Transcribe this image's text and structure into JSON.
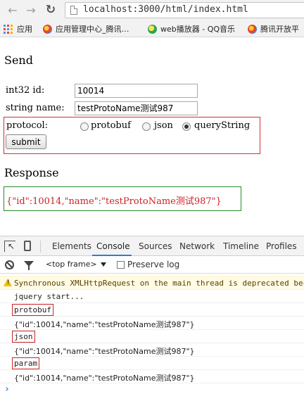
{
  "browser": {
    "url": "localhost:3000/html/index.html",
    "bookmarks": [
      {
        "label": "应用",
        "icon": "apps-grid-icon"
      },
      {
        "label": "应用管理中心_腾讯…",
        "icon": "qq-icon"
      },
      {
        "label": "web播放器 - QQ音乐",
        "icon": "qq-music-icon"
      },
      {
        "label": "腾讯开放平",
        "icon": "qq-icon"
      }
    ]
  },
  "page": {
    "send_heading": "Send",
    "id_label": "int32 id:",
    "id_value": "10014",
    "name_label": "string name:",
    "name_value": "testProtoName测试987",
    "protocol_label": "protocol:",
    "protocol_options": [
      {
        "label": "protobuf",
        "checked": false
      },
      {
        "label": "json",
        "checked": false
      },
      {
        "label": "queryString",
        "checked": true
      }
    ],
    "submit_label": "submit",
    "response_heading": "Response",
    "response_text": "{\"id\":10014,\"name\":\"testProtoName测试987\"}"
  },
  "devtools": {
    "tabs": [
      "Elements",
      "Console",
      "Sources",
      "Network",
      "Timeline",
      "Profiles"
    ],
    "active_tab": "Console",
    "frame_select": "<top frame>",
    "preserve_log_label": "Preserve log",
    "warning": "Synchronous XMLHttpRequest on the main thread is deprecated bec",
    "logs": [
      "jquery start...",
      "protobuf",
      "{\"id\":10014,\"name\":\"testProtoName测试987\"}",
      "json",
      "{\"id\":10014,\"name\":\"testProtoName测试987\"}",
      "param",
      "{\"id\":10014,\"name\":\"testProtoName测试987\"}"
    ],
    "prompt": "›"
  },
  "colors": {
    "highlight_border": "#cc3333",
    "response_border": "#2a8a2a",
    "response_text": "#cc2222",
    "active_tab_underline": "#3879d9"
  }
}
